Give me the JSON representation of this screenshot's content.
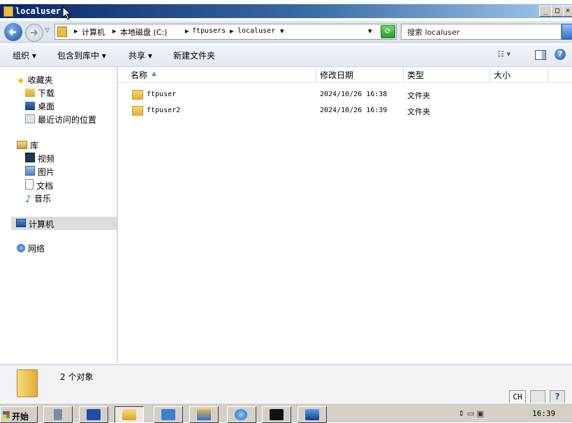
{
  "window": {
    "title": "localuser",
    "controls": [
      "_",
      "□",
      "×"
    ]
  },
  "address": {
    "crumbs": [
      "计算机",
      "本地磁盘 (C:)",
      "ftpusers",
      "localuser"
    ],
    "search_placeholder": "搜索 localuser"
  },
  "toolbar": {
    "organize": "组织 ▾",
    "include_library": "包含到库中 ▾",
    "share": "共享 ▾",
    "new_folder": "新建文件夹"
  },
  "nav": {
    "favorites": {
      "label": "收藏夹",
      "items": [
        "下载",
        "桌面",
        "最近访问的位置"
      ]
    },
    "library": {
      "label": "库",
      "items": [
        "视频",
        "图片",
        "文档",
        "音乐"
      ]
    },
    "computer": "计算机",
    "network": "网络"
  },
  "columns": {
    "name": "名称",
    "modified": "修改日期",
    "type": "类型",
    "size": "大小"
  },
  "files": [
    {
      "name": "ftpuser",
      "modified": "2024/10/26 16:38",
      "type": "文件夹",
      "size": ""
    },
    {
      "name": "ftpuser2",
      "modified": "2024/10/26 16:39",
      "type": "文件夹",
      "size": ""
    }
  ],
  "details": {
    "count": "2 个对象"
  },
  "taskbar": {
    "start": "开始",
    "lang": "CH",
    "clock": "16:39"
  },
  "colors": {
    "title_start": "#0a246a",
    "title_end": "#a6caf0",
    "folder": "#e3b23a",
    "accent": "#1e5fb4"
  }
}
